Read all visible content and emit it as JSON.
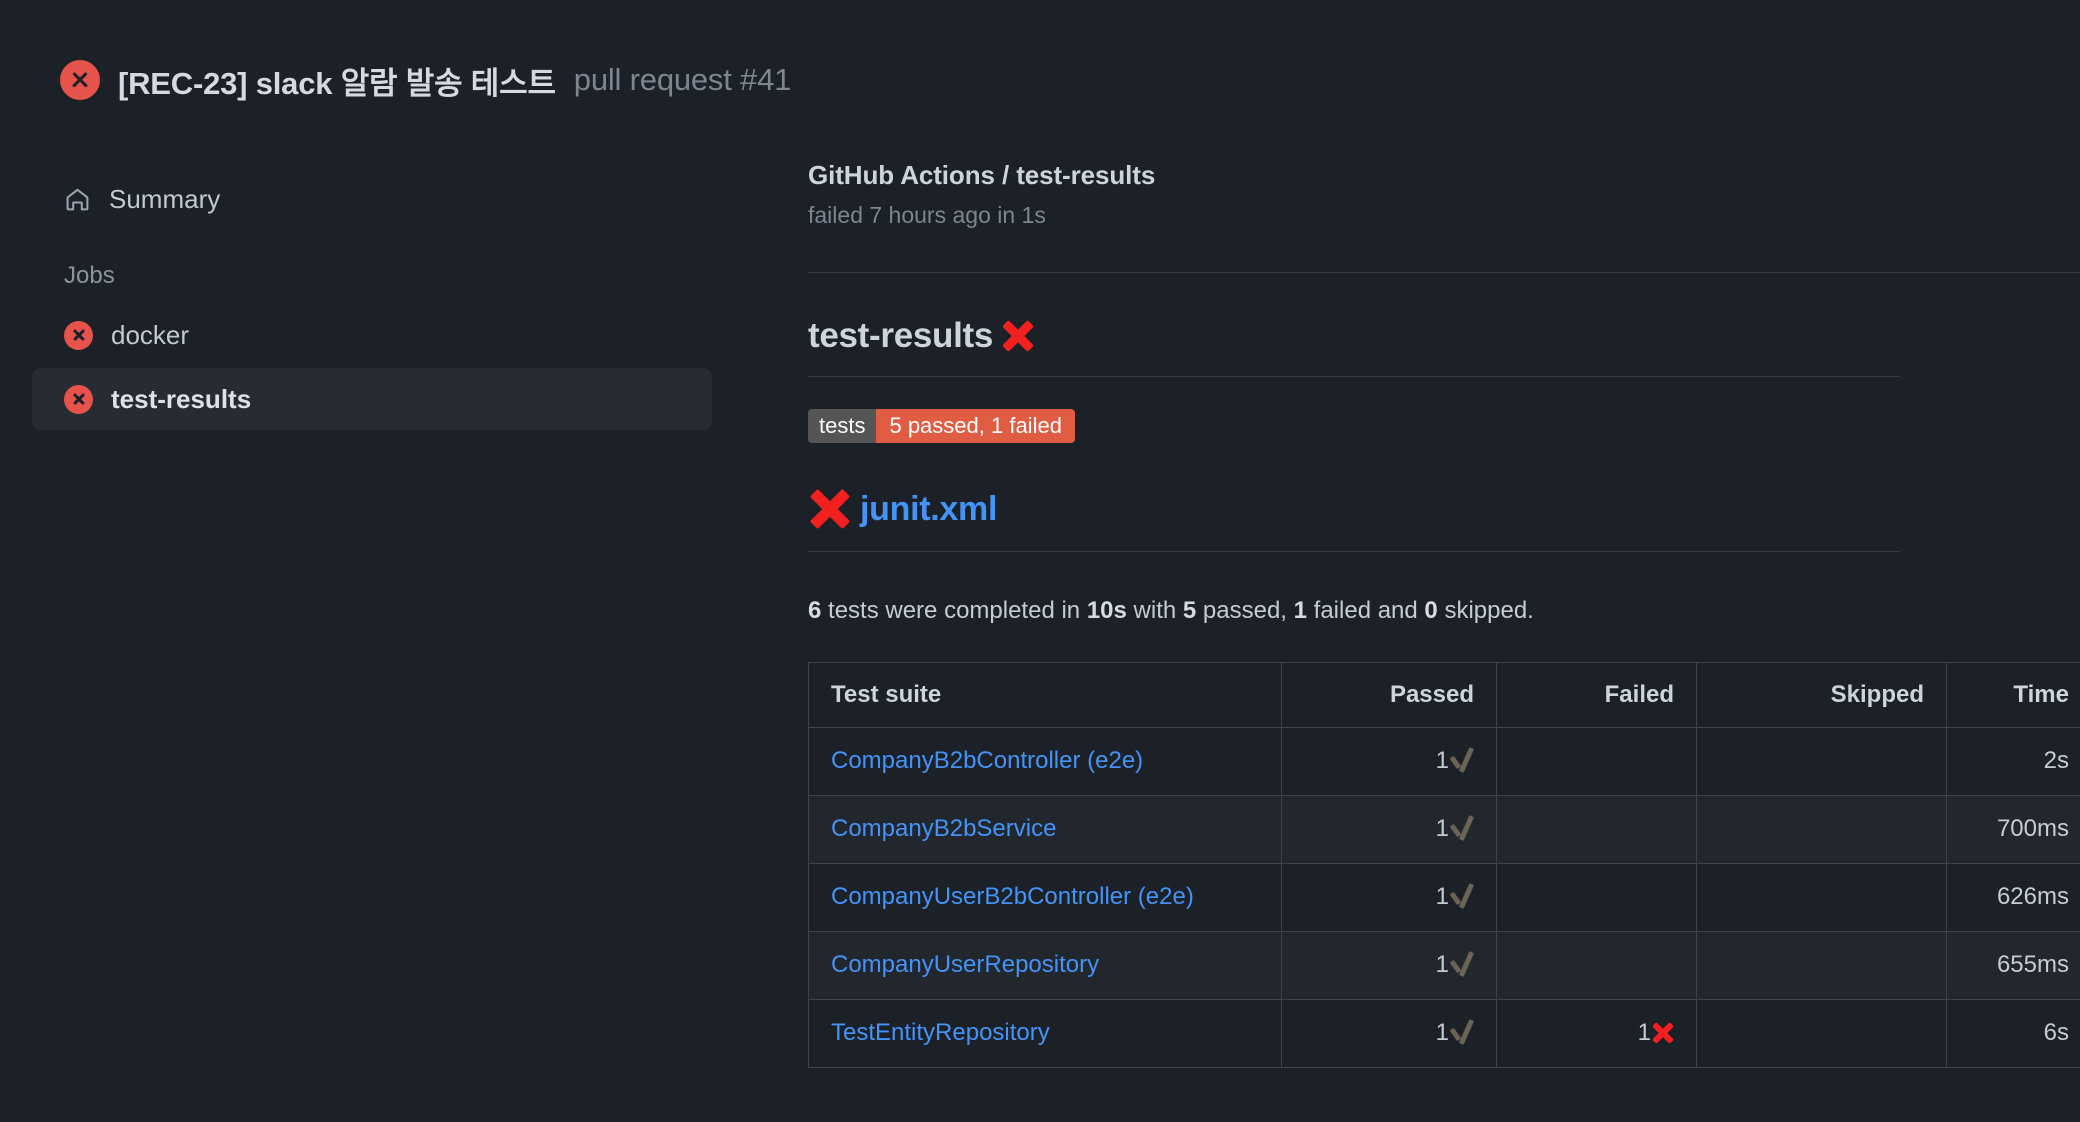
{
  "header": {
    "status_icon": "failure-x-circle-icon",
    "title": "[REC-23] slack 알람 발송 테스트",
    "subtitle": "pull request #41"
  },
  "sidebar": {
    "summary": {
      "icon": "home-icon",
      "label": "Summary"
    },
    "jobs_section_label": "Jobs",
    "jobs": [
      {
        "label": "docker",
        "status_icon": "failure-x-circle-icon",
        "selected": false
      },
      {
        "label": "test-results",
        "status_icon": "failure-x-circle-icon",
        "selected": true
      }
    ]
  },
  "main": {
    "check_title": "GitHub Actions / test-results",
    "check_meta": "failed 7 hours ago in 1s",
    "report_heading": "test-results",
    "report_heading_icon": "cross-mark-emoji",
    "badge": {
      "left_label": "tests",
      "right_label": "5 passed, 1 failed",
      "left_color": "#555555",
      "right_color": "#e05d44"
    },
    "file_heading": {
      "icon": "cross-mark-emoji",
      "link_text": "junit.xml",
      "link_color": "#4493f8"
    },
    "summary": {
      "total": "6",
      "text_1": " tests were completed in ",
      "duration": "10s",
      "text_2": " with ",
      "passed": "5",
      "text_3": " passed, ",
      "failed": "1",
      "text_4": " failed and ",
      "skipped": "0",
      "text_5": " skipped."
    },
    "table": {
      "columns": [
        "Test suite",
        "Passed",
        "Failed",
        "Skipped",
        "Time"
      ],
      "rows": [
        {
          "suite": "CompanyB2bController (e2e)",
          "passed": "1",
          "passed_icon": "check-mark-emoji",
          "failed": "",
          "failed_icon": "",
          "skipped": "",
          "time": "2s"
        },
        {
          "suite": "CompanyB2bService",
          "passed": "1",
          "passed_icon": "check-mark-emoji",
          "failed": "",
          "failed_icon": "",
          "skipped": "",
          "time": "700ms"
        },
        {
          "suite": "CompanyUserB2bController (e2e)",
          "passed": "1",
          "passed_icon": "check-mark-emoji",
          "failed": "",
          "failed_icon": "",
          "skipped": "",
          "time": "626ms"
        },
        {
          "suite": "CompanyUserRepository",
          "passed": "1",
          "passed_icon": "check-mark-emoji",
          "failed": "",
          "failed_icon": "",
          "skipped": "",
          "time": "655ms"
        },
        {
          "suite": "TestEntityRepository",
          "passed": "1",
          "passed_icon": "check-mark-emoji",
          "failed": "1",
          "failed_icon": "cross-mark-emoji",
          "skipped": "",
          "time": "6s"
        }
      ]
    }
  },
  "colors": {
    "page_bg": "#1c2128",
    "failure_red": "#e5534b",
    "cross_red": "#f41f1f",
    "link_blue": "#4493f8",
    "selected_bg": "#272c34",
    "border": "#3d444d"
  }
}
